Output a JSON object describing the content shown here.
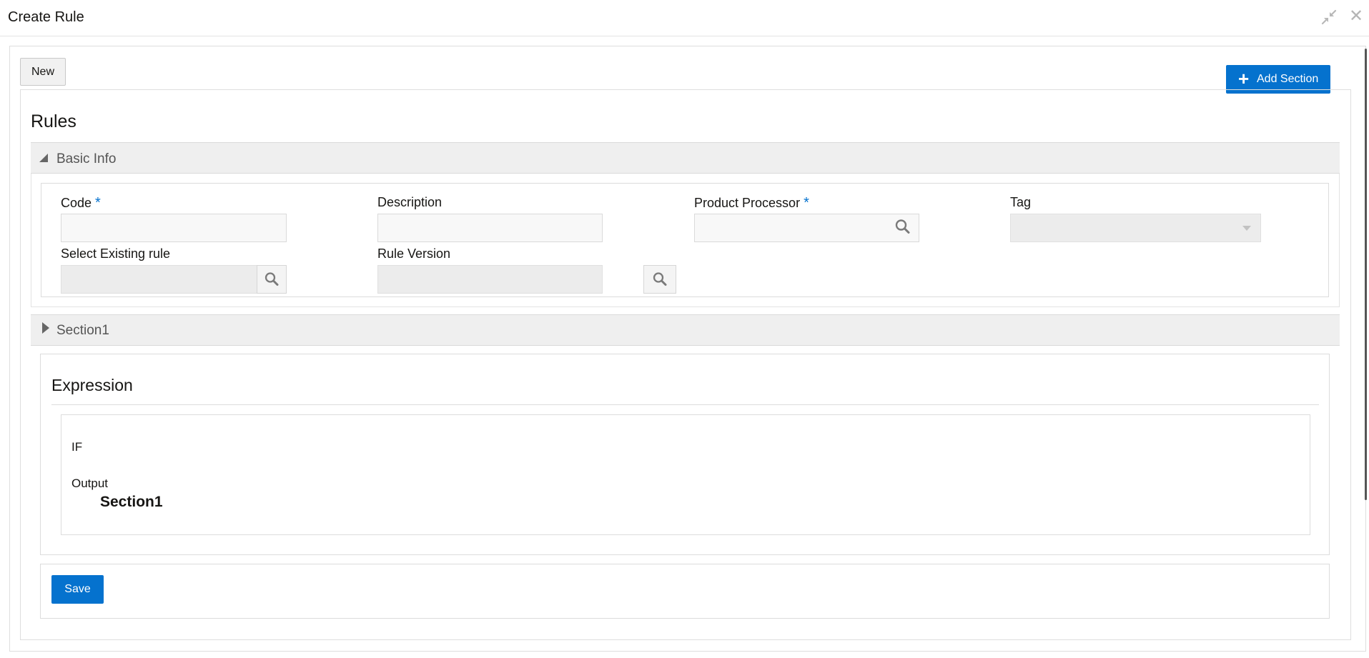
{
  "window": {
    "title": "Create Rule",
    "minimize_icon": "collapse-arrows-icon",
    "close_icon": "close-icon"
  },
  "toolbar": {
    "new_label": "New",
    "add_section_label": "Add Section",
    "add_section_icon": "plus-icon"
  },
  "page": {
    "title": "Rules"
  },
  "basic_info": {
    "header": "Basic Info",
    "expanded": true,
    "fields": {
      "code": {
        "label": "Code",
        "required_mark": "*",
        "value": ""
      },
      "description": {
        "label": "Description",
        "value": ""
      },
      "product_processor": {
        "label": "Product Processor",
        "required_mark": "*",
        "value": ""
      },
      "tag": {
        "label": "Tag",
        "value": ""
      },
      "select_existing_rule": {
        "label": "Select Existing rule",
        "value": ""
      },
      "rule_version": {
        "label": "Rule Version",
        "value": ""
      }
    }
  },
  "section1": {
    "header": "Section1",
    "expanded": false
  },
  "expression": {
    "title": "Expression",
    "if_label": "IF",
    "output_label": "Output",
    "output_value": "Section1"
  },
  "actions": {
    "save_label": "Save"
  },
  "colors": {
    "accent": "#0572ce",
    "header_bg": "#efefef",
    "disabled_bg": "#ececec"
  }
}
